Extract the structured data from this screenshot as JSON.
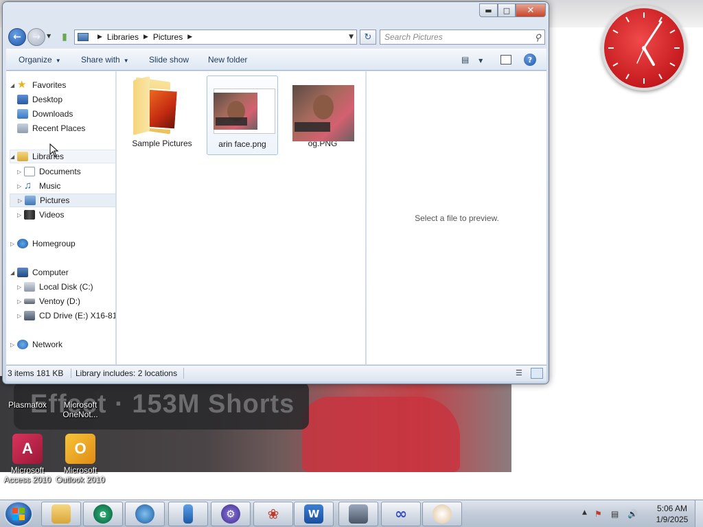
{
  "window": {
    "minimize_icon": "minimize-icon",
    "maximize_icon": "maximize-icon",
    "close_icon": "close-icon"
  },
  "address": {
    "crumbs": [
      "Libraries",
      "Pictures"
    ],
    "search_placeholder": "Search Pictures"
  },
  "command_bar": {
    "organize": "Organize",
    "share_with": "Share with",
    "slide_show": "Slide show",
    "new_folder": "New folder"
  },
  "nav_tree": {
    "favorites": "Favorites",
    "desktop": "Desktop",
    "downloads": "Downloads",
    "recent_places": "Recent Places",
    "libraries": "Libraries",
    "documents": "Documents",
    "music": "Music",
    "pictures": "Pictures",
    "videos": "Videos",
    "homegroup": "Homegroup",
    "computer": "Computer",
    "local_disk": "Local Disk (C:)",
    "ventoy": "Ventoy (D:)",
    "cd_drive": "CD Drive (E:) X16-81",
    "network": "Network"
  },
  "files": [
    {
      "name": "Sample Pictures",
      "type": "folder"
    },
    {
      "name": "arin face.png",
      "type": "image",
      "selected": true
    },
    {
      "name": "og.PNG",
      "type": "image"
    }
  ],
  "preview": {
    "message": "Select a file to preview."
  },
  "status": {
    "count": "3 items  181 KB",
    "library": "Library includes:  2 locations"
  },
  "desktop_icons": {
    "plasmafox": "Plasmafox",
    "onenote": "Microsoft OneNot...",
    "access": "Microsoft Access 2010",
    "outlook": "Microsoft Outlook 2010"
  },
  "video_banner": "Effect · 153M Shorts",
  "taskbar": {
    "time": "5:06 AM",
    "date": "1/9/2025",
    "pinned": [
      "explorer",
      "edge-browser",
      "globe-browser",
      "usb-tool",
      "settings-gear",
      "spider-app",
      "word",
      "remote-desktop",
      "infinity-app",
      "paint"
    ]
  },
  "colors": {
    "accent": "#1e57a8",
    "clock_face": "#c51a1e",
    "selection": "#eef4fb"
  }
}
